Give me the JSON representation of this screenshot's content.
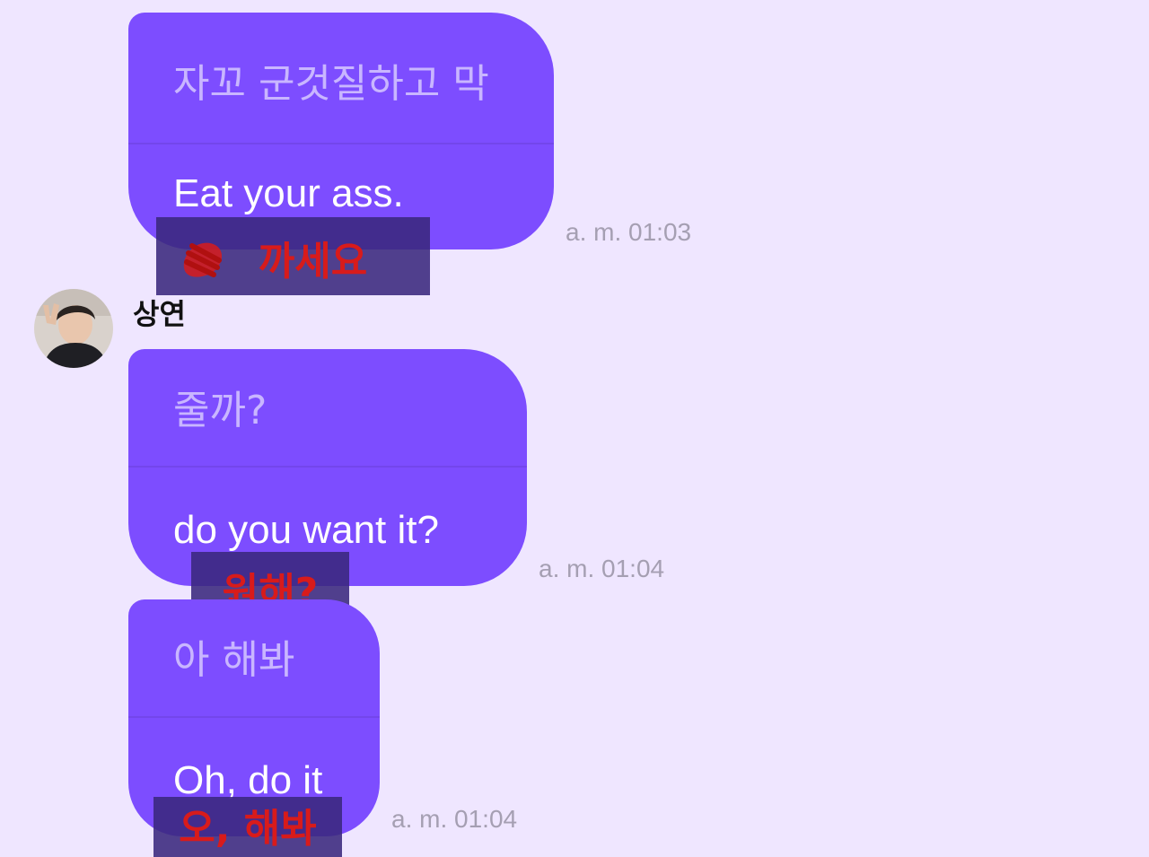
{
  "messages": [
    {
      "original": "자꼬 군것질하고 막",
      "translation": "Eat your ass.",
      "time": "a. m. 01:03",
      "overlay": "까세요"
    },
    {
      "original": "줄까?",
      "translation": "do you want it?",
      "time": "a. m. 01:04",
      "overlay": "원해?"
    },
    {
      "original": "아 해봐",
      "translation": "Oh, do it",
      "time": "a. m. 01:04",
      "overlay": "오, 해봐"
    }
  ],
  "sender": {
    "name": "상연",
    "avatar_icon": "user-avatar-photo"
  },
  "colors": {
    "background": "#efe6ff",
    "bubble": "#7d4dff",
    "original_text": "#c9b6ff",
    "translation_text": "#ffffff",
    "overlay_text": "#d81b1b",
    "timestamp": "#a59fb2"
  }
}
